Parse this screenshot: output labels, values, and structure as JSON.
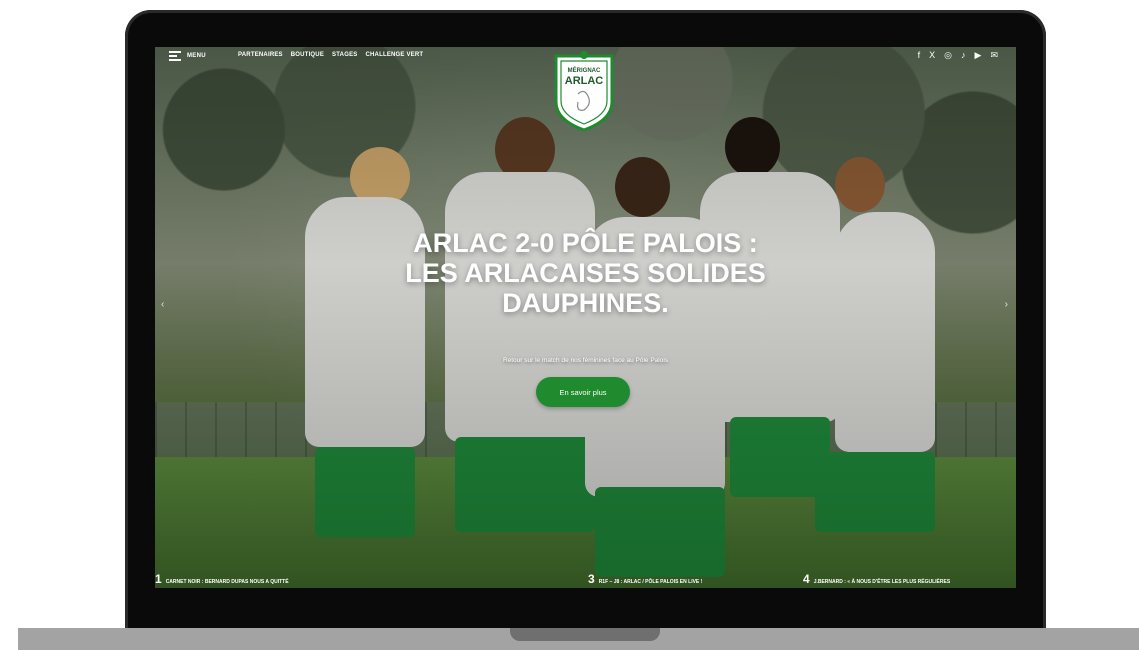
{
  "nav": {
    "menu_label": "MENU",
    "links": [
      "PARTENAIRES",
      "BOUTIQUE",
      "STAGES",
      "CHALLENGE VERT"
    ],
    "social_icons": [
      "facebook-icon",
      "x-icon",
      "instagram-icon",
      "tiktok-icon",
      "youtube-icon",
      "mail-icon"
    ],
    "social_glyphs": [
      "f",
      "X",
      "◎",
      "♪",
      "▶",
      "✉"
    ]
  },
  "logo": {
    "top_text": "MÉRIGNAC",
    "main_text": "ARLAC"
  },
  "hero": {
    "title": "ARLAC 2-0 PÔLE PALOIS : LES ARLACAISES SOLIDES DAUPHINES.",
    "subtitle": "Retour sur le match de nos féminines face au Pôle Palois",
    "cta_label": "En savoir plus",
    "prev_arrow": "‹",
    "next_arrow": "›"
  },
  "news": [
    {
      "num": "1",
      "text": "CARNET NOIR : BERNARD DUPAS NOUS A QUITTÉ"
    },
    {
      "num": "3",
      "text": "R1F – J8 : ARLAC / PÔLE PALOIS EN LIVE !"
    },
    {
      "num": "4",
      "text": "J.BERNARD : « À NOUS D'ÊTRE LES PLUS RÉGULIÈRES"
    }
  ],
  "colors": {
    "accent": "#1f8a2e",
    "kit_green": "#1f8a3a",
    "kit_white": "#d9dad6"
  }
}
